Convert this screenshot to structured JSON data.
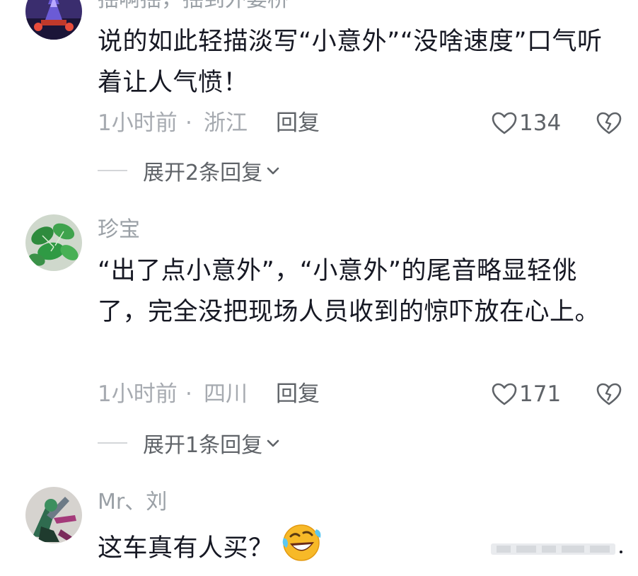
{
  "comments": [
    {
      "username": "揺啊揺，揺到外婆桥",
      "text": "说的如此轻描淡写“小意外”“没啥速度”口气听着让人气愤！",
      "time": "1小时前",
      "dot": "·",
      "location": "浙江",
      "reply_label": "回复",
      "likes": "134",
      "expand_label": "展开2条回复"
    },
    {
      "username": "珍宝",
      "text": "“出了点小意外”，“小意外”的尾音略显轻佻了，完全没把现场人员收到的惊吓放在心上。",
      "time": "1小时前",
      "dot": "·",
      "location": "四川",
      "reply_label": "回复",
      "likes": "171",
      "expand_label": "展开1条回复"
    },
    {
      "username": "Mr、刘",
      "text": "这车真有人买？"
    }
  ],
  "icons": {
    "like": "heart-outline-icon",
    "dislike": "broken-heart-icon",
    "expand": "chevron-down-icon",
    "emoji": "rolling-laughing-emoji"
  },
  "colors": {
    "text": "#161823",
    "secondary": "#a6aab0",
    "action": "#5f6368",
    "background": "#ffffff"
  }
}
